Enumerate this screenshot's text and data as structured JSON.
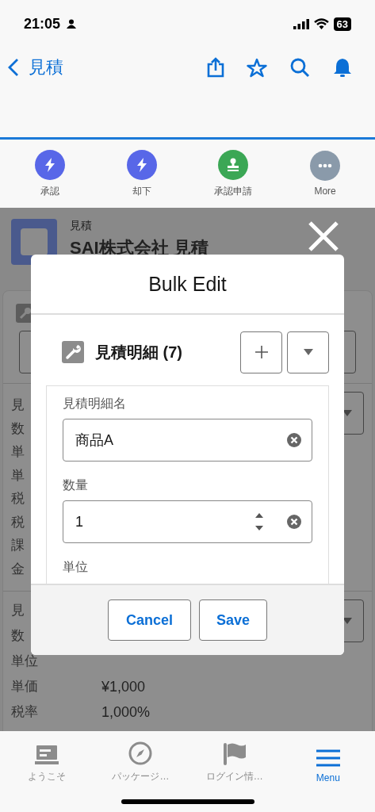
{
  "status_bar": {
    "time": "21:05",
    "battery": "63"
  },
  "nav": {
    "back_label": "見積"
  },
  "actions": [
    {
      "label": "承認",
      "kind": "bolt",
      "color": "#5867e8"
    },
    {
      "label": "却下",
      "kind": "bolt",
      "color": "#5867e8"
    },
    {
      "label": "承認申請",
      "kind": "stamp",
      "color": "#3ba755"
    },
    {
      "label": "More",
      "kind": "more",
      "color": "#8a9aaa"
    }
  ],
  "record": {
    "object_label": "見積",
    "title": "SAI株式会社 見積"
  },
  "related_card_1": {
    "rows": [
      "見",
      "数",
      "単",
      "単",
      "税",
      "税",
      "課",
      "金"
    ]
  },
  "related_card_2": {
    "rows": [
      {
        "label": "見"
      },
      {
        "label": "数"
      },
      {
        "label": "単位"
      },
      {
        "label": "単価",
        "value": "¥1,000"
      },
      {
        "label": "税率",
        "value": "1,000%"
      }
    ]
  },
  "modal": {
    "title": "Bulk Edit",
    "section_title": "見積明細 (7)",
    "fields": [
      {
        "label": "見積明細名",
        "kind": "text",
        "value": "商品A"
      },
      {
        "label": "数量",
        "kind": "number",
        "value": "1"
      },
      {
        "label": "単位",
        "kind": "label"
      }
    ],
    "buttons": [
      "Cancel",
      "Save"
    ]
  },
  "tabs": [
    {
      "label": "ようこそ",
      "kind": "welcome",
      "selected": false
    },
    {
      "label": "パッケージ…",
      "kind": "compass",
      "selected": false
    },
    {
      "label": "ログイン情…",
      "kind": "flag",
      "selected": false
    },
    {
      "label": "Menu",
      "kind": "menu",
      "selected": true
    }
  ]
}
